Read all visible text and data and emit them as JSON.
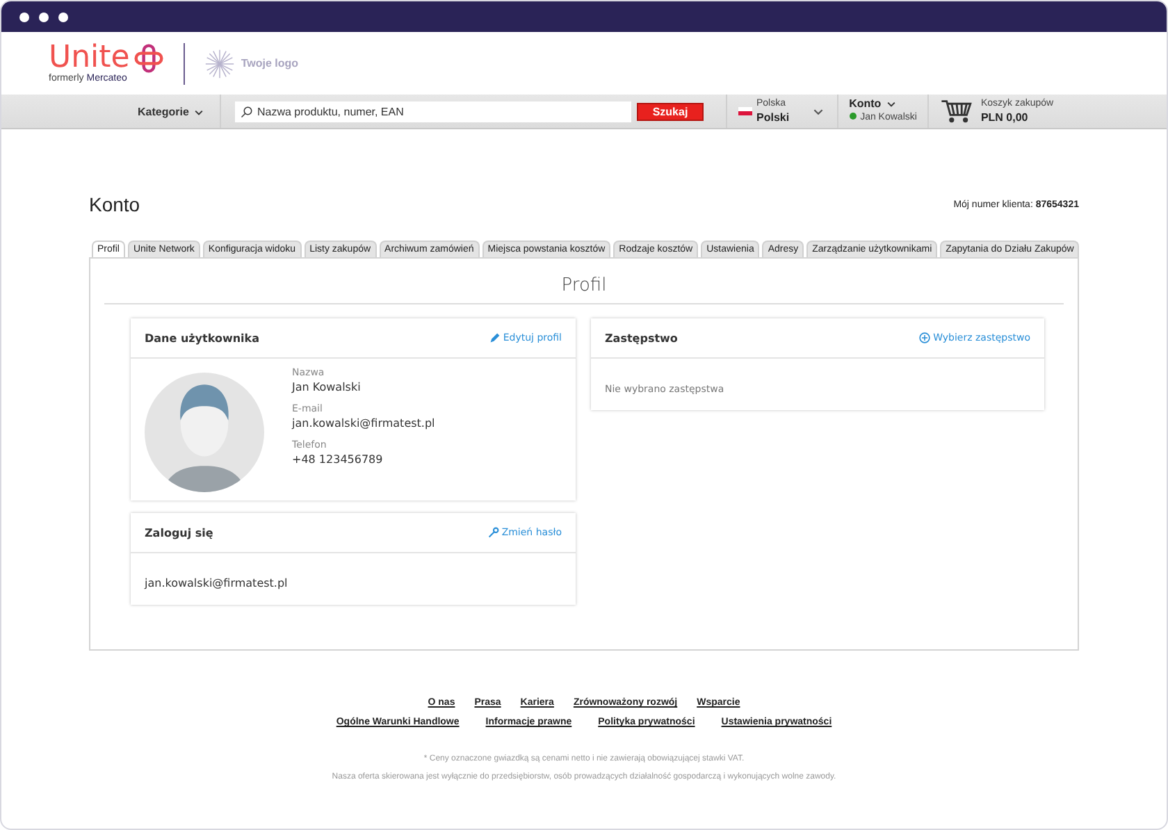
{
  "header": {
    "brand": "Unite",
    "brand_sub_prefix": "formerly",
    "brand_sub_name": "Mercateo",
    "partner_logo": "Twoje logo"
  },
  "navbar": {
    "categories": "Kategorie",
    "search": {
      "placeholder": "Nazwa produktu, numer, EAN"
    },
    "search_button": "Szukaj",
    "country": "Polska",
    "language": "Polski",
    "account_label": "Konto",
    "account_user": "Jan Kowalski",
    "account_online": true,
    "cart_label": "Koszyk zakupów",
    "cart_total": "PLN 0,00"
  },
  "page": {
    "title": "Konto",
    "customer_number_label": "Mój numer klienta:",
    "customer_number": "87654321"
  },
  "tabs": [
    {
      "label": "Profil",
      "selected": true
    },
    {
      "label": "Unite Network",
      "selected": false
    },
    {
      "label": "Konfiguracja widoku",
      "selected": false
    },
    {
      "label": "Listy zakupów",
      "selected": false
    },
    {
      "label": "Archiwum zamówień",
      "selected": false
    },
    {
      "label": "Miejsca powstania kosztów",
      "selected": false
    },
    {
      "label": "Rodzaje kosztów",
      "selected": false
    },
    {
      "label": "Ustawienia",
      "selected": false
    },
    {
      "label": "Adresy",
      "selected": false
    },
    {
      "label": "Zarządzanie użytkownikami",
      "selected": false
    },
    {
      "label": "Zapytania do Działu Zakupów",
      "selected": false
    }
  ],
  "section_title": "Profil",
  "user_card": {
    "title": "Dane użytkownika",
    "action": "Edytuj profil",
    "fields": [
      {
        "label": "Nazwa",
        "value": "Jan Kowalski"
      },
      {
        "label": "E-mail",
        "value": "jan.kowalski@firmatest.pl"
      },
      {
        "label": "Telefon",
        "value": "+48 123456789"
      }
    ]
  },
  "login_card": {
    "title": "Zaloguj się",
    "action": "Zmień hasło",
    "value": "jan.kowalski@firmatest.pl"
  },
  "substitute_card": {
    "title": "Zastępstwo",
    "action": "Wybierz zastępstwo",
    "empty_text": "Nie wybrano zastępstwa"
  },
  "footer": {
    "links_row_1": [
      "O nas",
      "Prasa",
      "Kariera",
      "Zrównoważony rozwój",
      "Wsparcie"
    ],
    "links_row_2": [
      "Ogólne Warunki Handlowe",
      "Informacje prawne",
      "Polityka prywatności",
      "Ustawienia prywatności"
    ],
    "notes": [
      "* Ceny oznaczone gwiazdką są cenami netto i nie zawierają obowiązującej stawki VAT.",
      "Nasza oferta skierowana jest wyłącznie do przedsiębiorstw, osób prowadzących działalność gospodarczą i wykonujących wolne zawody."
    ]
  }
}
